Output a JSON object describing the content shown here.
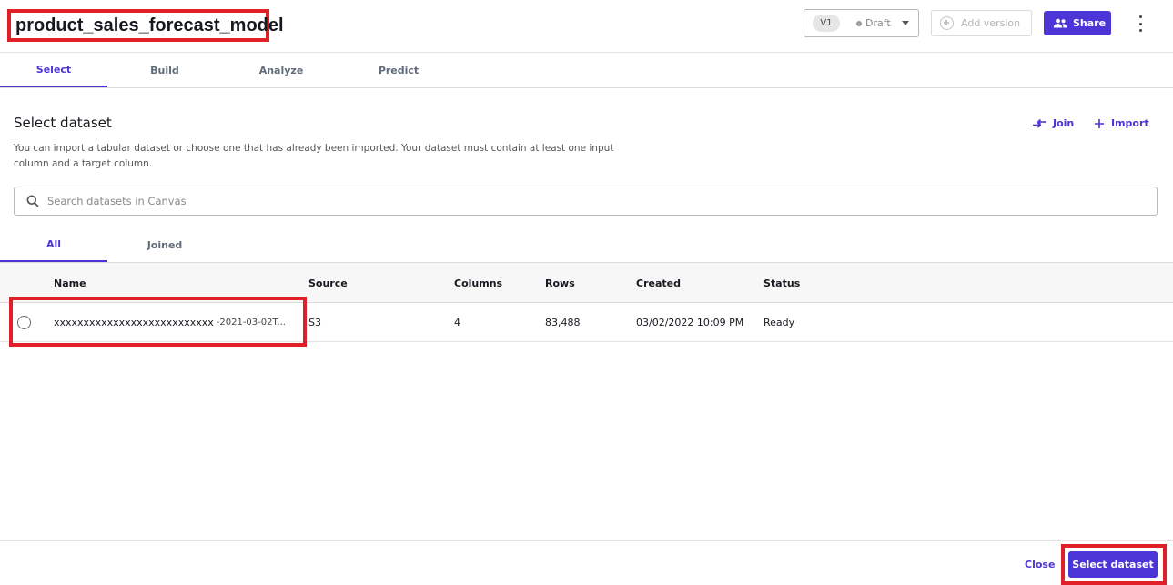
{
  "header": {
    "title": "product_sales_forecast_model",
    "version_label": "V1",
    "version_status": "Draft",
    "add_version_label": "Add version",
    "share_label": "Share"
  },
  "main_tabs": [
    {
      "label": "Select",
      "active": true
    },
    {
      "label": "Build",
      "active": false
    },
    {
      "label": "Analyze",
      "active": false
    },
    {
      "label": "Predict",
      "active": false
    }
  ],
  "section": {
    "title": "Select dataset",
    "description": "You can import a tabular dataset or choose one that has already been imported. Your dataset must contain at least one input column and a target column.",
    "join_label": "Join",
    "import_label": "Import"
  },
  "search": {
    "placeholder": "Search datasets in Canvas",
    "value": ""
  },
  "sub_tabs": [
    {
      "label": "All",
      "active": true
    },
    {
      "label": "Joined",
      "active": false
    }
  ],
  "table": {
    "columns": [
      "Name",
      "Source",
      "Columns",
      "Rows",
      "Created",
      "Status"
    ],
    "rows": [
      {
        "name": "xxxxxxxxxxxxxxxxxxxxxxxxxxx",
        "name_suffix": "-2021-03-02T...",
        "source": "S3",
        "columns": "4",
        "rows": "83,488",
        "created": "03/02/2022 10:09 PM",
        "status": "Ready",
        "selected": false
      }
    ]
  },
  "footer": {
    "close_label": "Close",
    "select_label": "Select dataset"
  },
  "colors": {
    "accent": "#4b35d6",
    "highlight": "#e01f26"
  }
}
